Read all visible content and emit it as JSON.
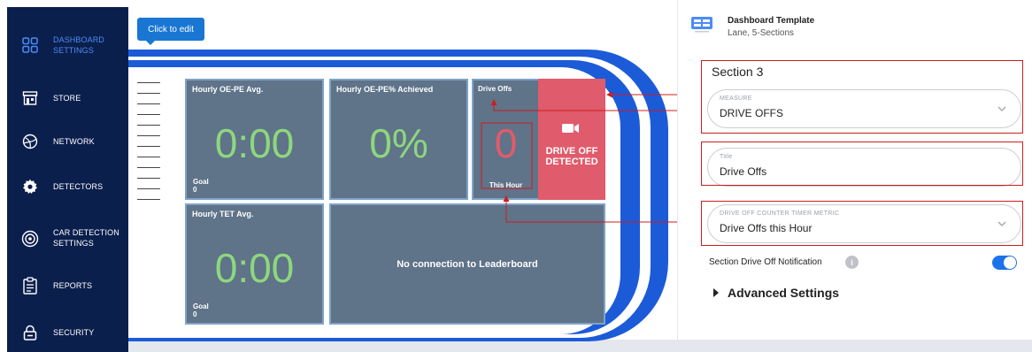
{
  "sidebar": {
    "items": [
      {
        "label": "DASHBOARD SETTINGS",
        "icon": "dashboard-icon",
        "active": true
      },
      {
        "label": "STORE",
        "icon": "store-icon"
      },
      {
        "label": "NETWORK",
        "icon": "network-icon"
      },
      {
        "label": "DETECTORS",
        "icon": "gear-icon"
      },
      {
        "label": "CAR DETECTION SETTINGS",
        "icon": "radar-icon"
      },
      {
        "label": "REPORTS",
        "icon": "clipboard-icon"
      },
      {
        "label": "SECURITY",
        "icon": "lock-icon"
      }
    ]
  },
  "canvas": {
    "click_to_edit": "Click to edit",
    "tiles": {
      "oe_pe_avg": {
        "title": "Hourly OE-PE Avg.",
        "value": "0:00",
        "goal_label": "Goal",
        "goal_value": "0"
      },
      "oe_pe_pct": {
        "title": "Hourly OE-PE% Achieved",
        "value": "0%"
      },
      "drive_offs": {
        "title": "Drive Offs",
        "value": "0",
        "sub": "This Hour"
      },
      "alert": {
        "text": "DRIVE OFF DETECTED",
        "icon": "video-camera-icon"
      },
      "tet_avg": {
        "title": "Hourly TET Avg.",
        "value": "0:00",
        "goal_label": "Goal",
        "goal_value": "0"
      },
      "leaderboard": {
        "text": "No connection to Leaderboard"
      }
    }
  },
  "panel": {
    "template_name": "Dashboard Template",
    "template_sub": "Lane, 5-Sections",
    "section_title": "Section 3",
    "measure": {
      "label": "MEASURE",
      "value": "DRIVE OFFS"
    },
    "title_field": {
      "label": "Title",
      "value": "Drive Offs"
    },
    "timer_metric": {
      "label": "DRIVE OFF COUNTER TIMER METRIC",
      "value": "Drive Offs this Hour"
    },
    "notification_label": "Section Drive Off Notification",
    "notification_on": true,
    "advanced": "Advanced Settings"
  },
  "colors": {
    "sidebar": "#0b1f4d",
    "accent": "#1976d2",
    "lane": "#1c5bd8",
    "tile": "#5f7389",
    "metric_green": "#8dd77d",
    "metric_red": "#e05b6b",
    "annotation": "#cc1e1e"
  }
}
